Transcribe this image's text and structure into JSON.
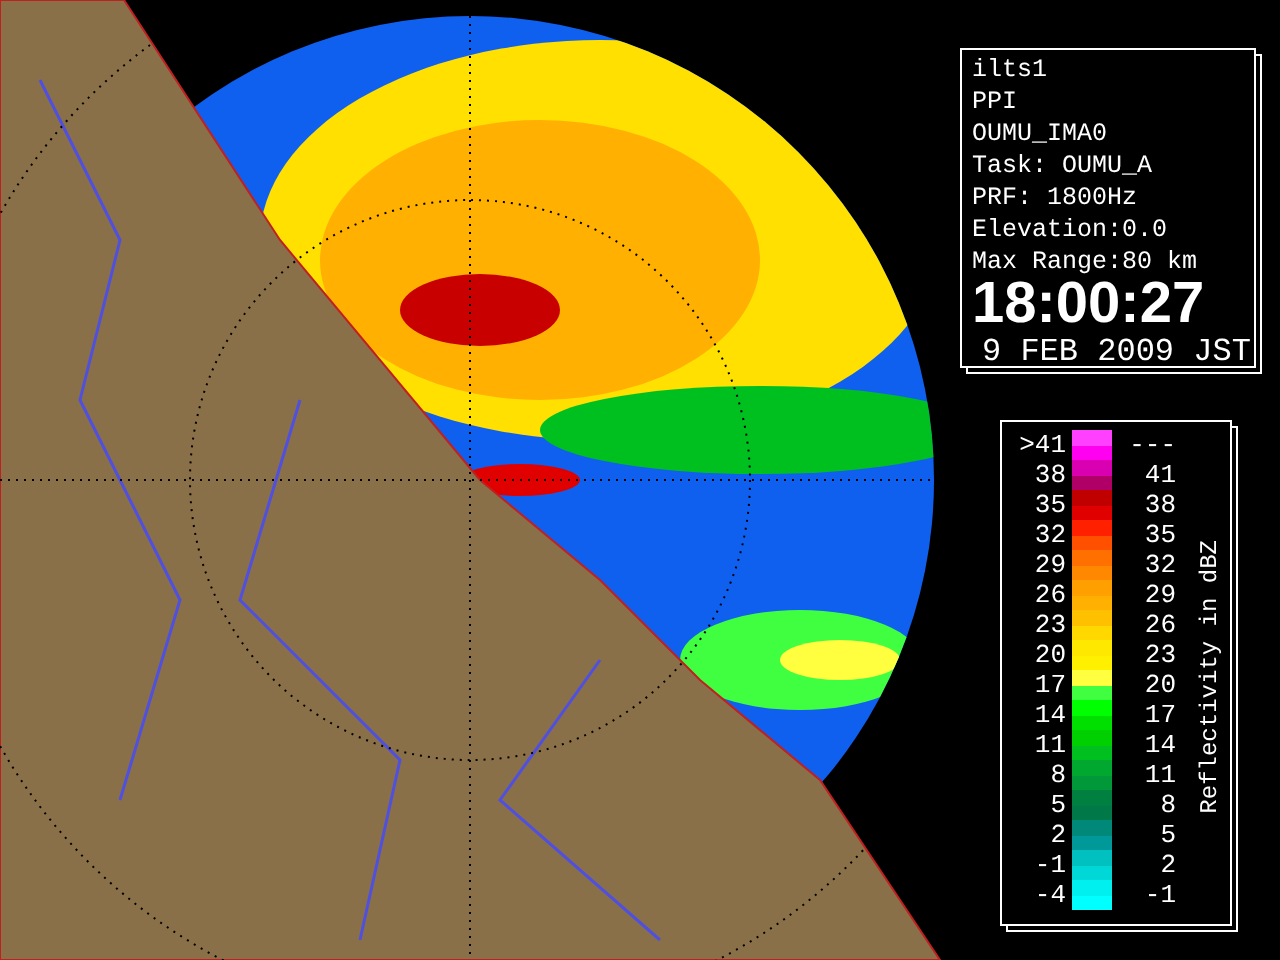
{
  "info_panel": {
    "lines": [
      "ilts1",
      "PPI",
      "OUMU_IMA0",
      "Task: OUMU_A",
      "PRF: 1800Hz",
      "Elevation:0.0",
      "Max Range:80 km"
    ],
    "time": "18:00:27",
    "date": "9 FEB 2009 JST"
  },
  "legend": {
    "title": "Reflectivity in dBZ",
    "rows": [
      {
        "low": ">41",
        "high": "---"
      },
      {
        "low": "38",
        "high": "41"
      },
      {
        "low": "35",
        "high": "38"
      },
      {
        "low": "32",
        "high": "35"
      },
      {
        "low": "29",
        "high": "32"
      },
      {
        "low": "26",
        "high": "29"
      },
      {
        "low": "23",
        "high": "26"
      },
      {
        "low": "20",
        "high": "23"
      },
      {
        "low": "17",
        "high": "20"
      },
      {
        "low": "14",
        "high": "17"
      },
      {
        "low": "11",
        "high": "14"
      },
      {
        "low": "8",
        "high": "11"
      },
      {
        "low": "5",
        "high": "8"
      },
      {
        "low": "2",
        "high": "5"
      },
      {
        "low": "-1",
        "high": "2"
      },
      {
        "low": "-4",
        "high": "-1"
      }
    ],
    "bands": [
      {
        "color": "#ff40ff"
      },
      {
        "color": "#ff00f0"
      },
      {
        "color": "#d800b0"
      },
      {
        "color": "#b00068"
      },
      {
        "color": "#c00000"
      },
      {
        "color": "#e00000"
      },
      {
        "color": "#ff2000"
      },
      {
        "color": "#ff5000"
      },
      {
        "color": "#ff7000"
      },
      {
        "color": "#ff8800"
      },
      {
        "color": "#ffa000"
      },
      {
        "color": "#ffb000"
      },
      {
        "color": "#ffc000"
      },
      {
        "color": "#ffd800"
      },
      {
        "color": "#ffe800"
      },
      {
        "color": "#fff000"
      },
      {
        "color": "#ffff40"
      },
      {
        "color": "#40ff40"
      },
      {
        "color": "#00ff00"
      },
      {
        "color": "#00e000"
      },
      {
        "color": "#00d000"
      },
      {
        "color": "#00c020"
      },
      {
        "color": "#00a830"
      },
      {
        "color": "#009838"
      },
      {
        "color": "#008040"
      },
      {
        "color": "#007848"
      },
      {
        "color": "#008878"
      },
      {
        "color": "#009898"
      },
      {
        "color": "#00c0c0"
      },
      {
        "color": "#00d8d8"
      },
      {
        "color": "#00f0f0"
      },
      {
        "color": "#00ffff"
      }
    ]
  }
}
